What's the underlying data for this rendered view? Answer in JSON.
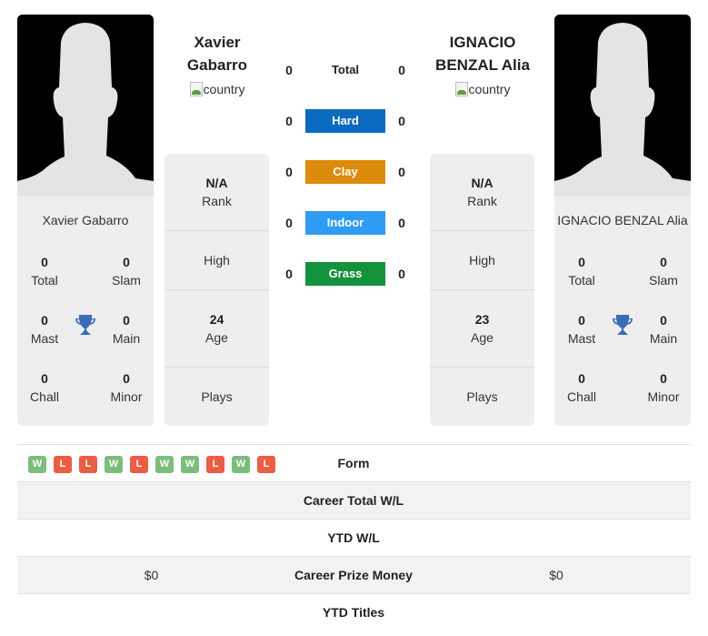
{
  "colors": {
    "hard": "#0b6bc1",
    "clay": "#dc8c0a",
    "indoor": "#2e9cf2",
    "grass": "#14913b",
    "win": "#7cbd7c",
    "loss": "#ec5d45",
    "trophy": "#3a6db5"
  },
  "players": [
    {
      "header_name_line1": "Xavier",
      "header_name_line2": "Gabarro",
      "flag_alt": "country",
      "card_name": "Xavier Gabarro",
      "titles": {
        "total": {
          "value": "0",
          "label": "Total"
        },
        "slam": {
          "value": "0",
          "label": "Slam"
        },
        "mast": {
          "value": "0",
          "label": "Mast"
        },
        "main": {
          "value": "0",
          "label": "Main"
        },
        "chall": {
          "value": "0",
          "label": "Chall"
        },
        "minor": {
          "value": "0",
          "label": "Minor"
        }
      },
      "stats": {
        "rank": {
          "value": "N/A",
          "label": "Rank"
        },
        "high": {
          "value": "",
          "label": "High"
        },
        "age": {
          "value": "24",
          "label": "Age"
        },
        "plays": {
          "value": "",
          "label": "Plays"
        }
      }
    },
    {
      "header_name_line1": "IGNACIO",
      "header_name_line2": "BENZAL Alia",
      "flag_alt": "country",
      "card_name": "IGNACIO BENZAL Alia",
      "titles": {
        "total": {
          "value": "0",
          "label": "Total"
        },
        "slam": {
          "value": "0",
          "label": "Slam"
        },
        "mast": {
          "value": "0",
          "label": "Mast"
        },
        "main": {
          "value": "0",
          "label": "Main"
        },
        "chall": {
          "value": "0",
          "label": "Chall"
        },
        "minor": {
          "value": "0",
          "label": "Minor"
        }
      },
      "stats": {
        "rank": {
          "value": "N/A",
          "label": "Rank"
        },
        "high": {
          "value": "",
          "label": "High"
        },
        "age": {
          "value": "23",
          "label": "Age"
        },
        "plays": {
          "value": "",
          "label": "Plays"
        }
      }
    }
  ],
  "surfaces": [
    {
      "key": "total",
      "label": "Total",
      "left": "0",
      "right": "0"
    },
    {
      "key": "hard",
      "label": "Hard",
      "left": "0",
      "right": "0"
    },
    {
      "key": "clay",
      "label": "Clay",
      "left": "0",
      "right": "0"
    },
    {
      "key": "indoor",
      "label": "Indoor",
      "left": "0",
      "right": "0"
    },
    {
      "key": "grass",
      "label": "Grass",
      "left": "0",
      "right": "0"
    }
  ],
  "form": [
    "W",
    "L",
    "L",
    "W",
    "L",
    "W",
    "W",
    "L",
    "W",
    "L"
  ],
  "table": {
    "rows": [
      {
        "label": "Form",
        "left": "",
        "right": ""
      },
      {
        "label": "Career Total W/L",
        "left": "",
        "right": ""
      },
      {
        "label": "YTD W/L",
        "left": "",
        "right": ""
      },
      {
        "label": "Career Prize Money",
        "left": "$0",
        "right": "$0"
      },
      {
        "label": "YTD Titles",
        "left": "",
        "right": ""
      }
    ]
  }
}
